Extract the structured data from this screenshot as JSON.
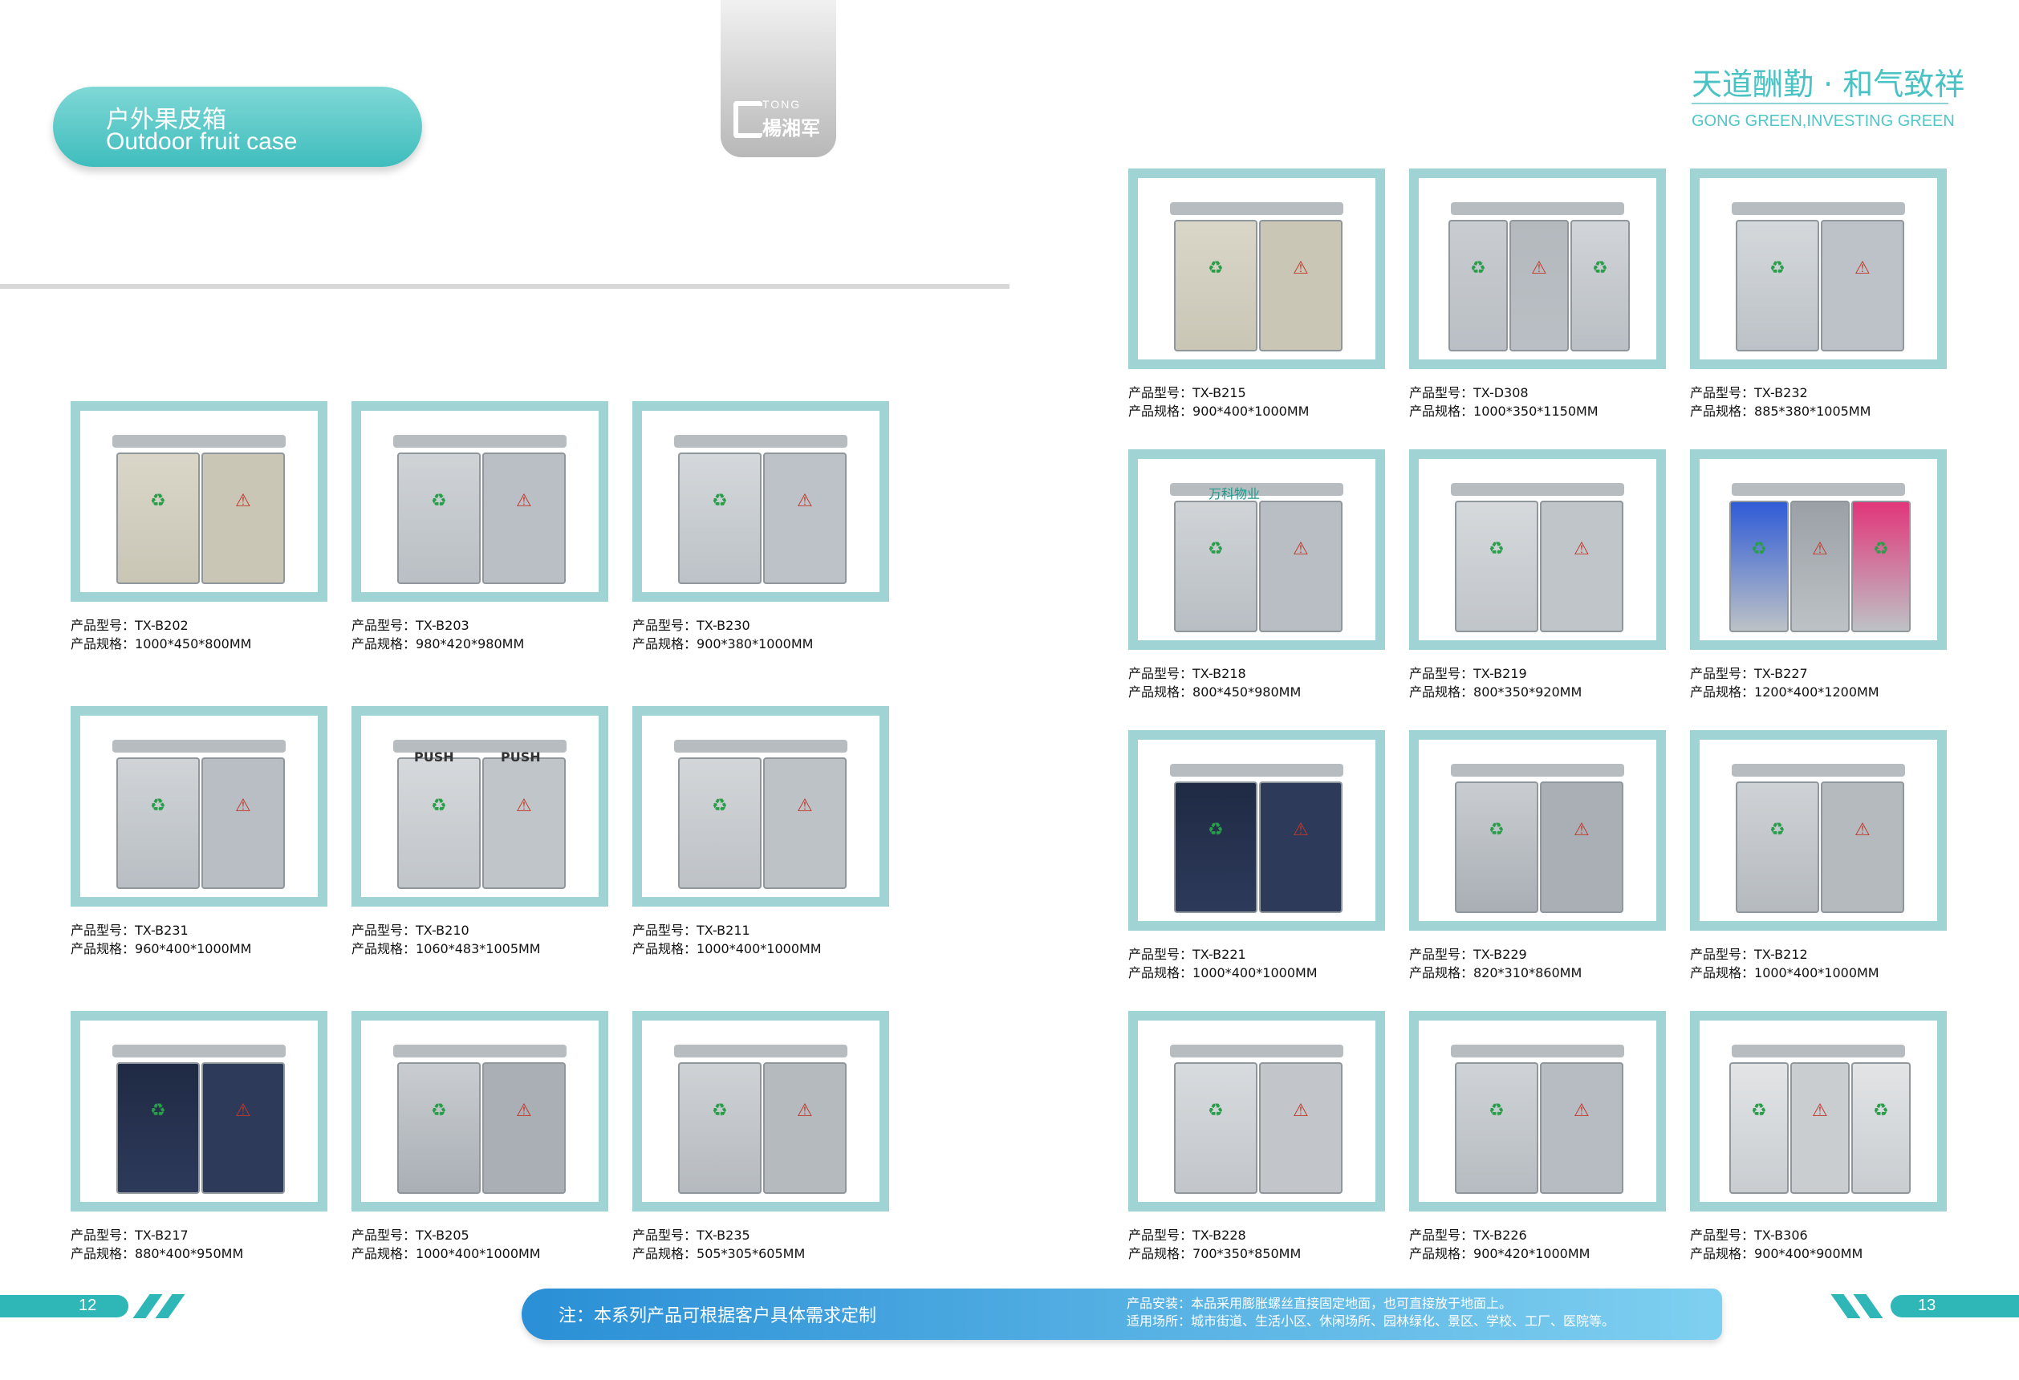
{
  "header": {
    "title_zh": "户外果皮箱",
    "title_en": "Outdoor fruit case",
    "logo_top": "TONG",
    "logo_name": "楊湘军",
    "slogan_zh": "天道酬勤 · 和气致祥",
    "slogan_en": "GONG GREEN,INVESTING GREEN"
  },
  "labels": {
    "model": "产品型号：",
    "spec": "产品规格："
  },
  "left_products": [
    {
      "model": "TX-B202",
      "spec": "1000*450*800MM"
    },
    {
      "model": "TX-B203",
      "spec": "980*420*980MM"
    },
    {
      "model": "TX-B230",
      "spec": "900*380*1000MM"
    },
    {
      "model": "TX-B231",
      "spec": "960*400*1000MM"
    },
    {
      "model": "TX-B210",
      "spec": "1060*483*1005MM"
    },
    {
      "model": "TX-B211",
      "spec": "1000*400*1000MM"
    },
    {
      "model": "TX-B217",
      "spec": "880*400*950MM"
    },
    {
      "model": "TX-B205",
      "spec": "1000*400*1000MM"
    },
    {
      "model": "TX-B235",
      "spec": "505*305*605MM"
    }
  ],
  "right_products": [
    {
      "model": "TX-B215",
      "spec": "900*400*1000MM"
    },
    {
      "model": "TX-D308",
      "spec": "1000*350*1150MM"
    },
    {
      "model": "TX-B232",
      "spec": "885*380*1005MM"
    },
    {
      "model": "TX-B218",
      "spec": "800*450*980MM"
    },
    {
      "model": "TX-B219",
      "spec": "800*350*920MM"
    },
    {
      "model": "TX-B227",
      "spec": "1200*400*1200MM"
    },
    {
      "model": "TX-B221",
      "spec": "1000*400*1000MM"
    },
    {
      "model": "TX-B229",
      "spec": "820*310*860MM"
    },
    {
      "model": "TX-B212",
      "spec": "1000*400*1000MM"
    },
    {
      "model": "TX-B228",
      "spec": "700*350*850MM"
    },
    {
      "model": "TX-B226",
      "spec": "900*420*1000MM"
    },
    {
      "model": "TX-B306",
      "spec": "900*400*900MM"
    }
  ],
  "product_photo_texts": {
    "push": "PUSH",
    "brand_218": "万科物业"
  },
  "footer": {
    "page_left": "12",
    "page_right": "13",
    "note": "注：本系列产品可根据客户具体需求定制",
    "install": "产品安装：本品采用膨胀螺丝直接固定地面，也可直接放于地面上。",
    "usage": "适用场所：城市街道、生活小区、休闲场所、园林绿化、景区、学校、工厂、医院等。"
  },
  "colors": {
    "accent": "#3fbdbd",
    "frame": "#9fd3d4",
    "note_bar": "#2a8fd6"
  }
}
